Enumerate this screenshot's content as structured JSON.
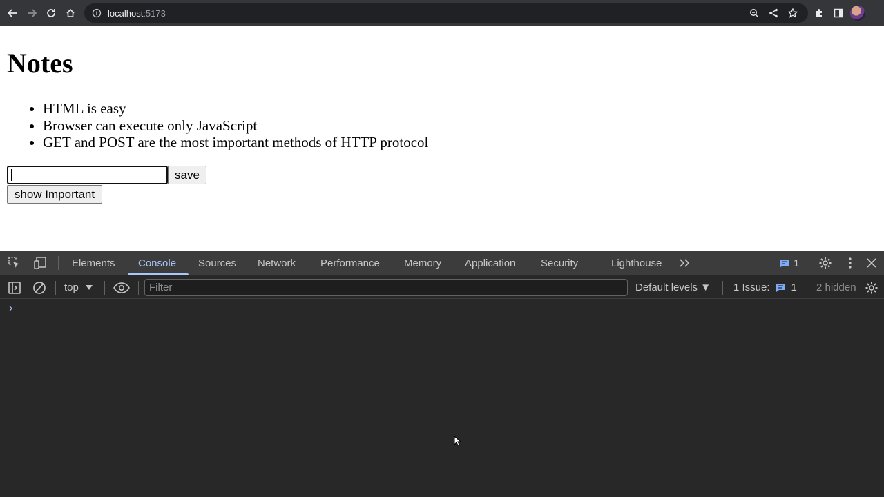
{
  "browser": {
    "url_host": "localhost",
    "url_port": ":5173",
    "icons": [
      "back-icon",
      "forward-icon",
      "reload-icon",
      "home-icon",
      "site-info-icon",
      "zoom-icon",
      "share-icon",
      "bookmark-star-icon",
      "extensions-icon",
      "side-panel-icon",
      "profile-avatar"
    ]
  },
  "page": {
    "title": "Notes",
    "notes": [
      "HTML is easy",
      "Browser can execute only JavaScript",
      "GET and POST are the most important methods of HTTP protocol"
    ],
    "input_value": "",
    "save_label": "save",
    "show_important_label": "show Important"
  },
  "devtools": {
    "tabs": [
      "Elements",
      "Console",
      "Sources",
      "Network",
      "Performance",
      "Memory",
      "Application",
      "Security",
      "Lighthouse"
    ],
    "active_tab": "Console",
    "issues_badge_count": "1",
    "toolbar": {
      "context": "top",
      "filter_placeholder": "Filter",
      "levels": "Default levels ▼",
      "issues_label": "1 Issue:",
      "issues_count": "1",
      "hidden_label": "2 hidden"
    },
    "prompt": "›",
    "accent_color": "#a8c7fa"
  }
}
